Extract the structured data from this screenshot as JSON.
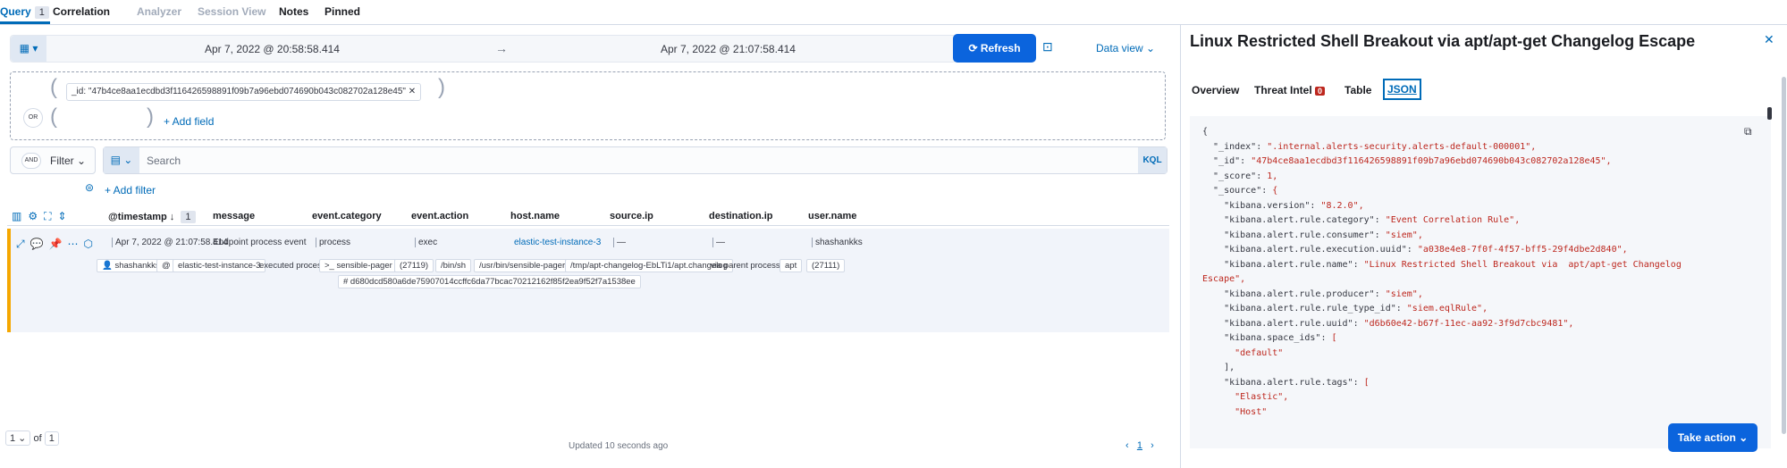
{
  "tabs": [
    {
      "label": "Query",
      "count": "1"
    },
    {
      "label": "Correlation"
    },
    {
      "label": "Analyzer"
    },
    {
      "label": "Session View"
    },
    {
      "label": "Notes"
    },
    {
      "label": "Pinned"
    }
  ],
  "datepicker": {
    "start": "Apr 7, 2022 @ 20:58:58.414",
    "end": "Apr 7, 2022 @ 21:07:58.414",
    "arrow": "→"
  },
  "refresh_label": "Refresh",
  "data_view_label": "Data view",
  "query_builder": {
    "pill": "_id: \"47b4ce8aa1ecdbd3f116426598891f09b7a96ebd074690b043c082702a128e45\"",
    "or_label": "OR",
    "add_field": "+ Add field"
  },
  "filter": {
    "and_label": "AND",
    "filter_label": "Filter",
    "search_placeholder": "Search",
    "kql_label": "KQL",
    "add_filter": "+ Add filter"
  },
  "table": {
    "columns": [
      "@timestamp",
      "message",
      "event.category",
      "event.action",
      "host.name",
      "source.ip",
      "destination.ip",
      "user.name"
    ],
    "sort_count": "1",
    "row": {
      "timestamp": "Apr 7, 2022 @ 21:07:58.414",
      "message": "Endpoint process event",
      "event_category": "process",
      "event_action": "exec",
      "host_name": "elastic-test-instance-3",
      "source_ip": "—",
      "destination_ip": "—",
      "user_name": "shashankks"
    },
    "renderer": {
      "user": "shashankks",
      "at": "@",
      "host": "elastic-test-instance-3",
      "executed": "executed process",
      "process": ">_ sensible-pager",
      "pid": "(27119)",
      "bin_sh": "/bin/sh",
      "exe": "/usr/bin/sensible-pager",
      "changelog": "/tmp/apt-changelog-EbLTi1/apt.changelog",
      "via_parent": "via parent process",
      "parent": "apt",
      "ppid": "(27111)",
      "hash": "# d680dcd580a6de75907014ccffc6da77bcac70212162f85f2ea9f52f7a1538ee"
    }
  },
  "pagination": {
    "page": "1",
    "of": "of",
    "total": "1",
    "updated": "Updated 10 seconds ago",
    "current": "1"
  },
  "flyout": {
    "title": "Linux Restricted Shell Breakout via apt/apt-get Changelog Escape",
    "tabs": [
      "Overview",
      "Threat Intel",
      "Table",
      "JSON"
    ],
    "threat_intel_count": "0",
    "json_lines": [
      "{",
      "  \"_index\": \".internal.alerts-security.alerts-default-000001\",",
      "  \"_id\": \"47b4ce8aa1ecdbd3f116426598891f09b7a96ebd074690b043c082702a128e45\",",
      "  \"_score\": 1,",
      "  \"_source\": {",
      "    \"kibana.version\": \"8.2.0\",",
      "    \"kibana.alert.rule.category\": \"Event Correlation Rule\",",
      "    \"kibana.alert.rule.consumer\": \"siem\",",
      "    \"kibana.alert.rule.execution.uuid\": \"a038e4e8-7f0f-4f57-bff5-29f4dbe2d840\",",
      "    \"kibana.alert.rule.name\": \"Linux Restricted Shell Breakout via  apt/apt-get Changelog",
      "Escape\",",
      "    \"kibana.alert.rule.producer\": \"siem\",",
      "    \"kibana.alert.rule.rule_type_id\": \"siem.eqlRule\",",
      "    \"kibana.alert.rule.uuid\": \"d6b60e42-b67f-11ec-aa92-3f9d7cbc9481\",",
      "    \"kibana.space_ids\": [",
      "      \"default\"",
      "    ],",
      "    \"kibana.alert.rule.tags\": [",
      "      \"Elastic\",",
      "      \"Host\""
    ],
    "take_action": "Take action"
  }
}
